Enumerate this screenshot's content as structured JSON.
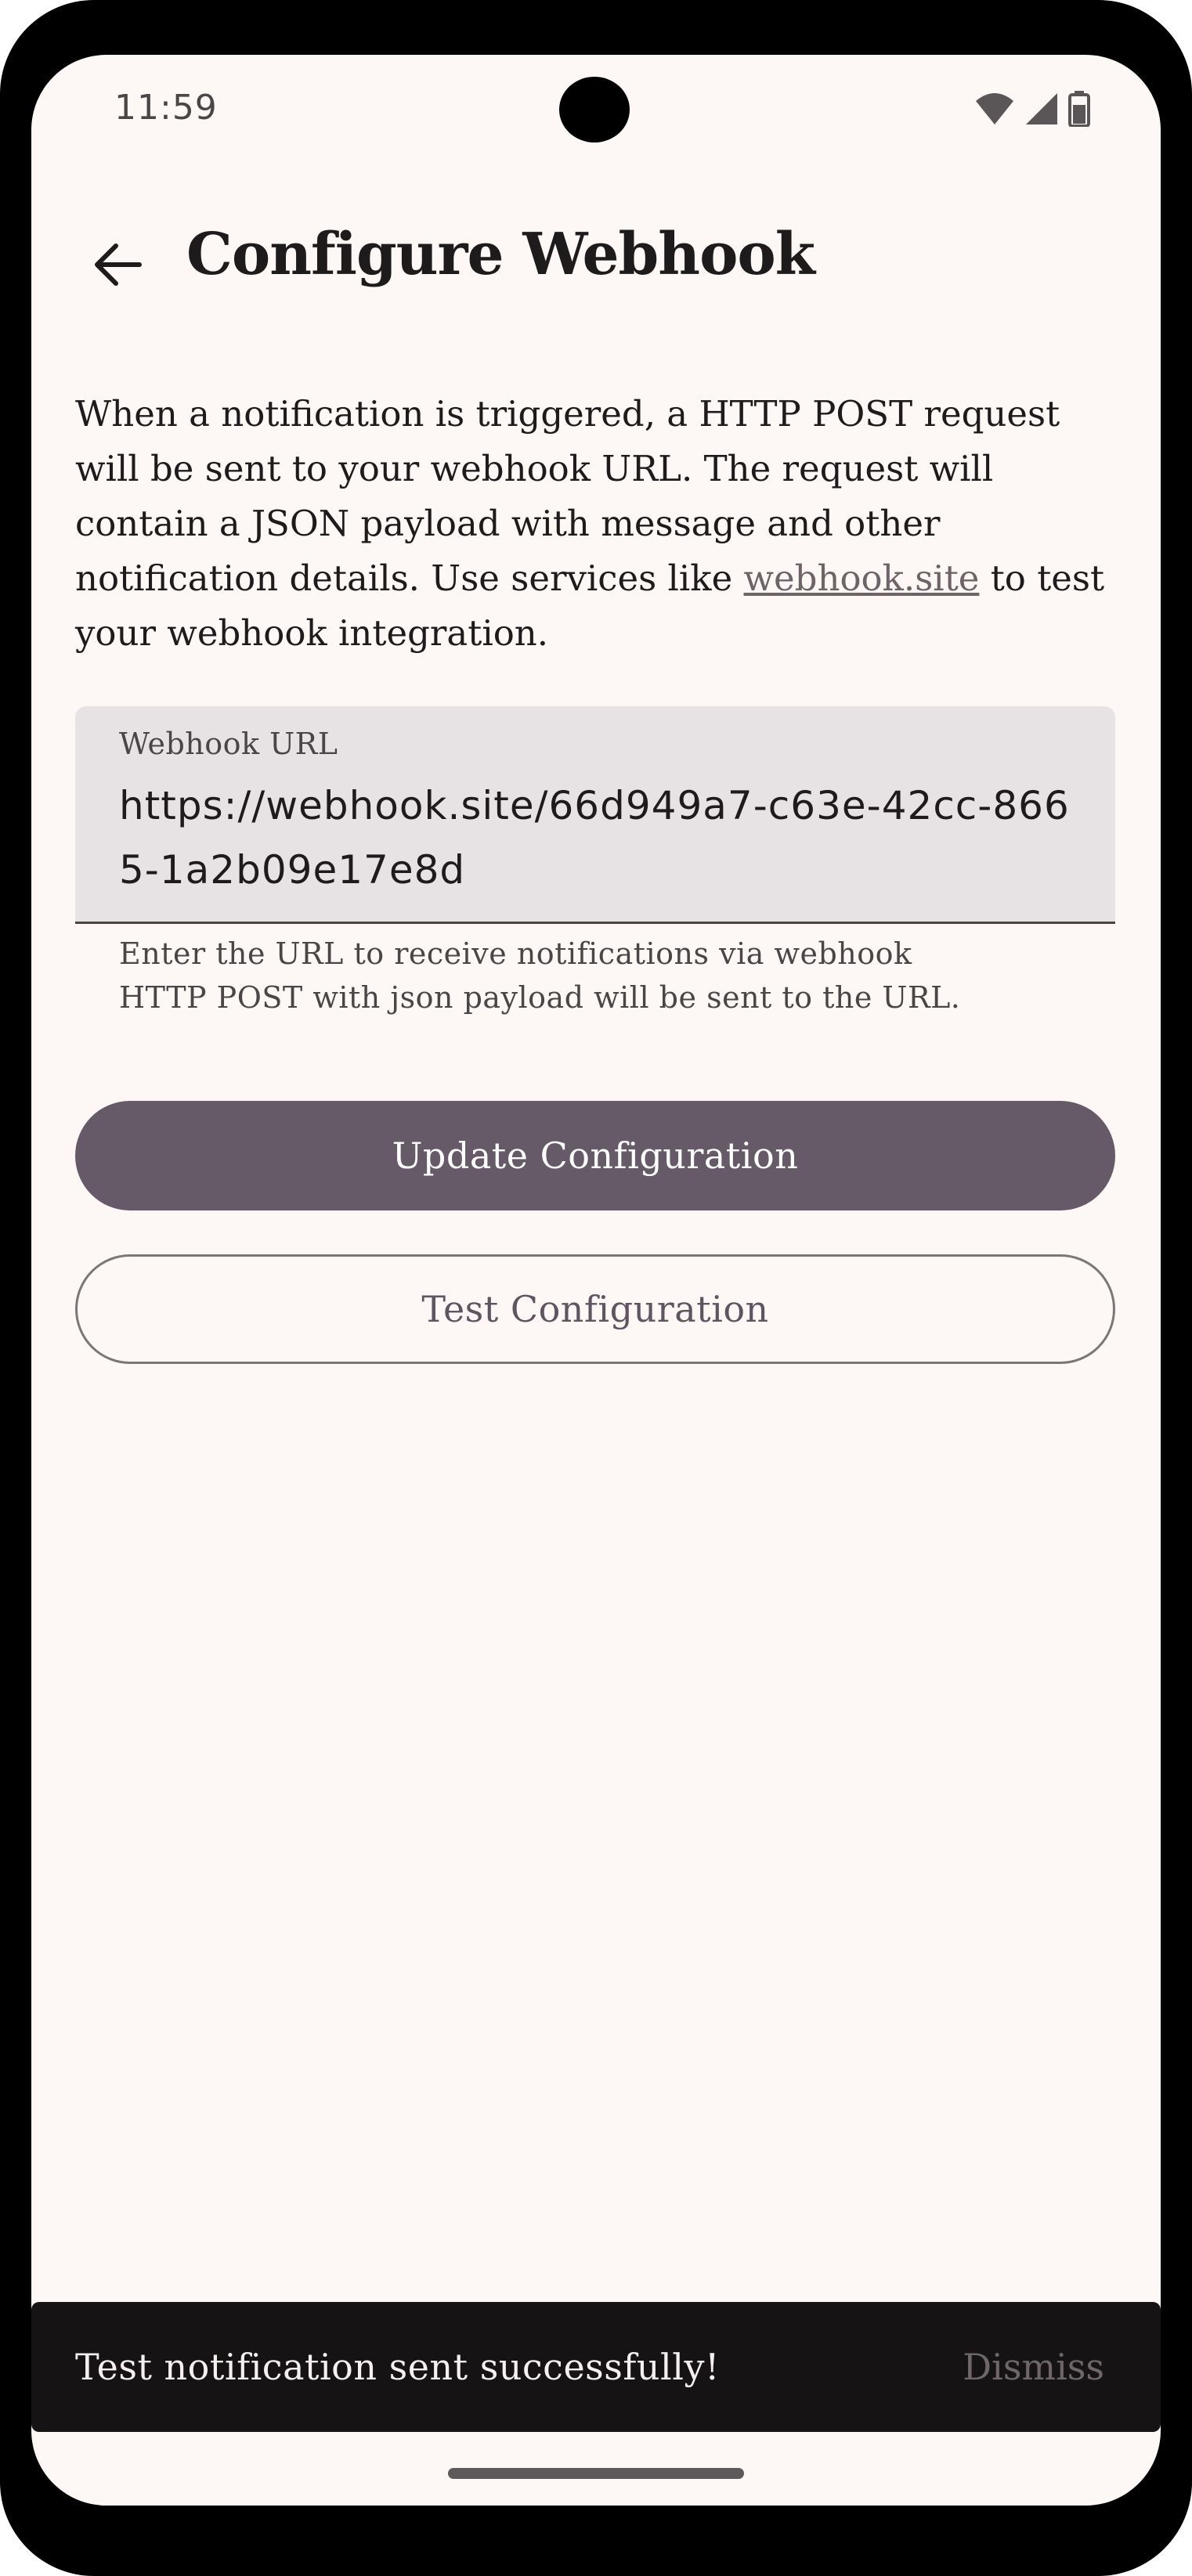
{
  "status_bar": {
    "time": "11:59"
  },
  "app_bar": {
    "back_icon": "arrow-back-icon",
    "title": "Configure Webhook"
  },
  "description": {
    "part1": "When a notification is triggered, a HTTP POST request will be sent to your webhook URL. The request will contain a JSON payload with message and other notification details. Use services like ",
    "link_text": "webhook.site",
    "part2": " to test your webhook integration."
  },
  "webhook_field": {
    "label": "Webhook URL",
    "value": "https://webhook.site/66d949a7-c63e-42cc-8665-1a2b09e17e8d",
    "supporting_text_line1": "Enter the URL to receive notifications via webhook",
    "supporting_text_line2": "HTTP POST with json payload will be sent to the URL."
  },
  "buttons": {
    "update": "Update Configuration",
    "test": "Test Configuration"
  },
  "snackbar": {
    "message": "Test notification sent successfully!",
    "action": "Dismiss"
  },
  "colors": {
    "background": "#fdf7f6",
    "primary": "#675a68",
    "field_background": "#e7e2e3",
    "snackbar_background": "#161314"
  }
}
